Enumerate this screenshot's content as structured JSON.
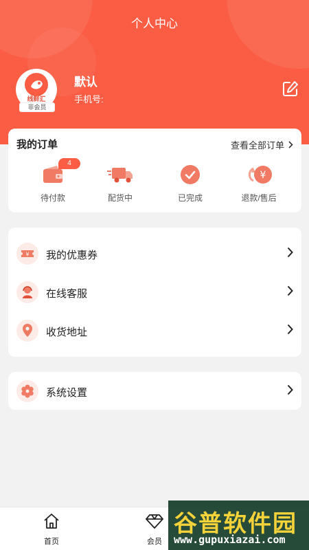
{
  "header": {
    "title": "个人中心"
  },
  "profile": {
    "name": "默认",
    "phone_label": "手机号:",
    "avatar_text": "线鲜汇",
    "member_badge": "非会员"
  },
  "orders": {
    "title": "我的订单",
    "view_all": "查看全部订单",
    "items": [
      {
        "label": "待付款",
        "icon": "wallet-icon",
        "badge": "4"
      },
      {
        "label": "配货中",
        "icon": "delivery-truck-icon"
      },
      {
        "label": "已完成",
        "icon": "check-circle-icon"
      },
      {
        "label": "退款/售后",
        "icon": "refund-yen-icon"
      }
    ]
  },
  "menu": {
    "items": [
      {
        "label": "我的优惠券",
        "icon": "coupon-icon"
      },
      {
        "label": "在线客服",
        "icon": "customer-service-icon"
      },
      {
        "label": "收货地址",
        "icon": "location-pin-icon"
      }
    ]
  },
  "settings": {
    "label": "系统设置",
    "icon": "gear-icon"
  },
  "tabbar": {
    "items": [
      {
        "label": "首页",
        "icon": "home-icon"
      },
      {
        "label": "会员",
        "icon": "diamond-icon"
      }
    ]
  },
  "watermark": {
    "line1": "谷普软件园",
    "line2": "www.gupuxiazai.com"
  },
  "colors": {
    "accent": "#fa5d44",
    "icon_bg": "#fdebe7"
  }
}
